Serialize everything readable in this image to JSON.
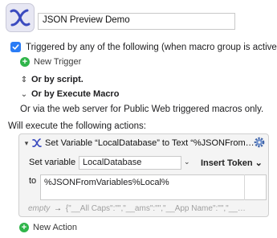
{
  "macro": {
    "name": "JSON Preview Demo"
  },
  "triggers": {
    "enabled_label": "Triggered by any of the following (when macro group is active):",
    "new_trigger": "New Trigger",
    "by_script": "Or by script.",
    "by_execute_macro": "Or by Execute Macro",
    "web_server": "Or via the web server for Public Web triggered macros only."
  },
  "actions": {
    "heading": "Will execute the following actions:",
    "items": [
      {
        "title": "Set Variable “LocalDatabase” to Text “%JSONFrom…",
        "set_variable_label": "Set variable",
        "variable_name": "LocalDatabase",
        "insert_token_label": "Insert Token ⌄",
        "to_label": "to",
        "text_value": "%JSONFromVariables%Local%",
        "result_empty": "empty",
        "result_preview": "{\"__All Caps\":\"\",\"__ams\":\"\",\"__App Name\":\"\",\"__…"
      }
    ],
    "new_action": "New Action"
  },
  "colors": {
    "accent": "#2a7cf5",
    "add_green": "#2fb54a",
    "macro_x": "#3b4bbf"
  },
  "icons": {
    "macro": "keyboard-maestro-x-icon",
    "checkbox": "checkmark-icon",
    "add": "plus-circle-icon",
    "gear": "gear-icon",
    "disclosure": "disclosure-triangle-icon"
  }
}
